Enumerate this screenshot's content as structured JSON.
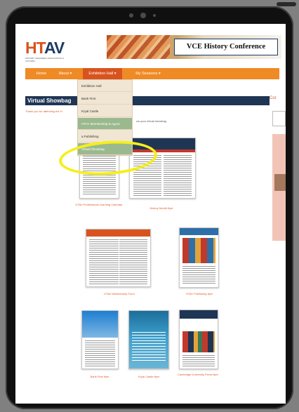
{
  "header": {
    "logo_main_1": "HT",
    "logo_main_2": "AV",
    "logo_sub": "HISTORY TEACHERS' ASSOCIATION of VICTORIA",
    "banner_title": "VCE History Conference"
  },
  "nav": {
    "items": [
      {
        "label": "Home"
      },
      {
        "label": "About ▾"
      },
      {
        "label": "Exhibition Hall ▾"
      },
      {
        "label": "My Sessions ▾"
      }
    ]
  },
  "dropdown": {
    "items": [
      {
        "label": "Exhibition Hall"
      },
      {
        "label": "Bank First"
      },
      {
        "label": "Kryal Castle"
      },
      {
        "label": "HTAV Membership & Agora"
      },
      {
        "label": "a Publishing"
      },
      {
        "label": "Virtual Showbag"
      }
    ]
  },
  "content": {
    "page_title": "Virtual Showbag",
    "thanks_text": "Thank you for attending the H",
    "thanks_text_2": "ow your virtual showbag.",
    "side_label": "Cor"
  },
  "documents": [
    {
      "caption": "HTAV Professional Learning Calendar",
      "accent": "#e05a2a"
    },
    {
      "caption": "History Month flyer",
      "accent": "#c0392b"
    },
    {
      "caption": "HTAV Membership Form",
      "accent": "#d9531e"
    },
    {
      "caption": "HTAV Publishing flyer",
      "accent": "#2e6fa8"
    },
    {
      "caption": "Bank First flyer",
      "accent": "#1e7fd0"
    },
    {
      "caption": "Kryal Castle flyer",
      "accent": "#1b6e9b"
    },
    {
      "caption": "Cambridge University Press flyer",
      "accent": "#1f3554"
    }
  ],
  "colors": {
    "nav": "#ef8a25",
    "nav_active": "#d9531e",
    "title_bar": "#1f3554",
    "highlight": "#f5ef1a",
    "link": "#e05a2a"
  }
}
